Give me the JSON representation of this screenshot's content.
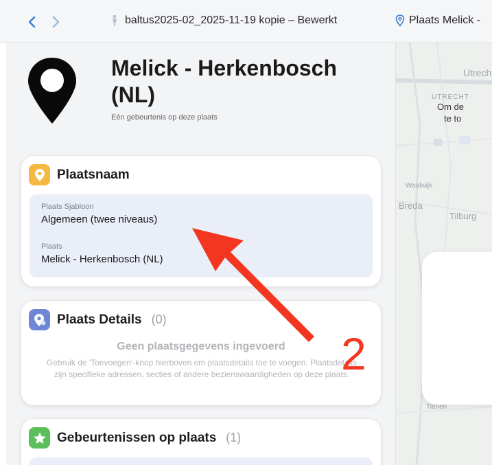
{
  "toolbar": {
    "back_label": "‹",
    "forward_label": "›",
    "document_title": "baltus2025-02_2025-11-19 kopie – Bewerkt",
    "place_tab_label": "Plaats Melick -"
  },
  "place": {
    "title": "Melick - Herkenbosch (NL)",
    "subtitle": "Eén gebeurtenis op deze plaats"
  },
  "plaatsnaam_card": {
    "title": "Plaatsnaam",
    "template_label": "Plaats Sjabloon",
    "template_value": "Algemeen (twee niveaus)",
    "place_label": "Plaats",
    "place_value": "Melick - Herkenbosch (NL)"
  },
  "details_card": {
    "title": "Plaats Details",
    "count": "(0)",
    "empty_title": "Geen plaatsgegevens ingevoerd",
    "empty_text": "Gebruik de 'Toevoegen'-knop hierboven om plaatsdetails toe te voegen. Plaatsdetails zijn specifieke adressen, secties of andere bezienswaardigheden op deze plaats."
  },
  "events_card": {
    "title": "Gebeurtenissen op plaats",
    "count": "(1)"
  },
  "map": {
    "labels": [
      "Utrecht",
      "UTRECHT",
      "Waalwijk",
      "Breda",
      "Tilburg",
      "Tienen"
    ],
    "card_text_line1": "Om de",
    "card_text_line2": "te to"
  },
  "annotation": {
    "number": "2",
    "color": "#f2361f"
  },
  "colors": {
    "plaatsnaam_icon": "#f5b942",
    "details_icon": "#6f86d6",
    "events_icon": "#5bbf5b",
    "accent_blue": "#3a7bd5"
  }
}
